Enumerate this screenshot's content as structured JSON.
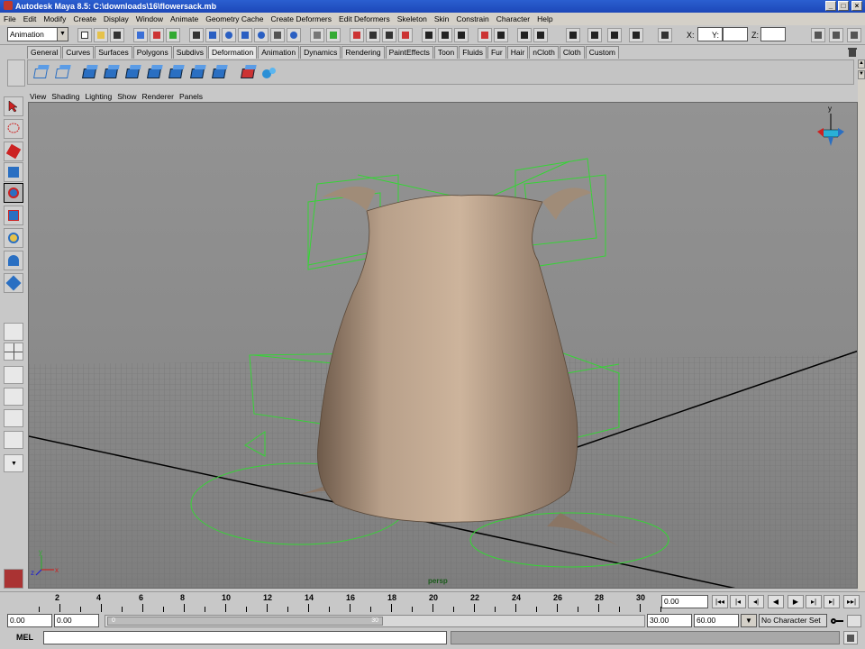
{
  "window": {
    "title": "Autodesk Maya 8.5: C:\\downloads\\16\\flowersack.mb"
  },
  "menu": [
    "File",
    "Edit",
    "Modify",
    "Create",
    "Display",
    "Window",
    "Animate",
    "Geometry Cache",
    "Create Deformers",
    "Edit Deformers",
    "Skeleton",
    "Skin",
    "Constrain",
    "Character",
    "Help"
  ],
  "status": {
    "mode": "Animation",
    "x_label": "X:",
    "y_label": "Y:",
    "z_label": "Z:"
  },
  "shelf_tabs": [
    {
      "label": "General",
      "active": false
    },
    {
      "label": "Curves",
      "active": false
    },
    {
      "label": "Surfaces",
      "active": false
    },
    {
      "label": "Polygons",
      "active": false
    },
    {
      "label": "Subdivs",
      "active": false
    },
    {
      "label": "Deformation",
      "active": true
    },
    {
      "label": "Animation",
      "active": false
    },
    {
      "label": "Dynamics",
      "active": false
    },
    {
      "label": "Rendering",
      "active": false
    },
    {
      "label": "PaintEffects",
      "active": false
    },
    {
      "label": "Toon",
      "active": false
    },
    {
      "label": "Fluids",
      "active": false
    },
    {
      "label": "Fur",
      "active": false
    },
    {
      "label": "Hair",
      "active": false
    },
    {
      "label": "nCloth",
      "active": false
    },
    {
      "label": "Cloth",
      "active": false
    },
    {
      "label": "Custom",
      "active": false
    }
  ],
  "panel_menu": [
    "View",
    "Shading",
    "Lighting",
    "Show",
    "Renderer",
    "Panels"
  ],
  "viewport": {
    "camera": "persp",
    "axis_x": "x",
    "axis_y": "y",
    "axis_z": "z",
    "compass_y": "y"
  },
  "timeline": {
    "ticks": [
      "2",
      "4",
      "6",
      "8",
      "10",
      "12",
      "14",
      "16",
      "18",
      "20",
      "22",
      "24",
      "26",
      "28",
      "30"
    ],
    "start_frame": "0",
    "current_time": "0.00",
    "range_start": "0.00",
    "anim_start": "0.00",
    "slider_start": "0",
    "slider_end": "30",
    "range_end": "30.00",
    "anim_end": "60.00",
    "character_set": "No Character Set"
  },
  "mel": {
    "label": "MEL"
  }
}
